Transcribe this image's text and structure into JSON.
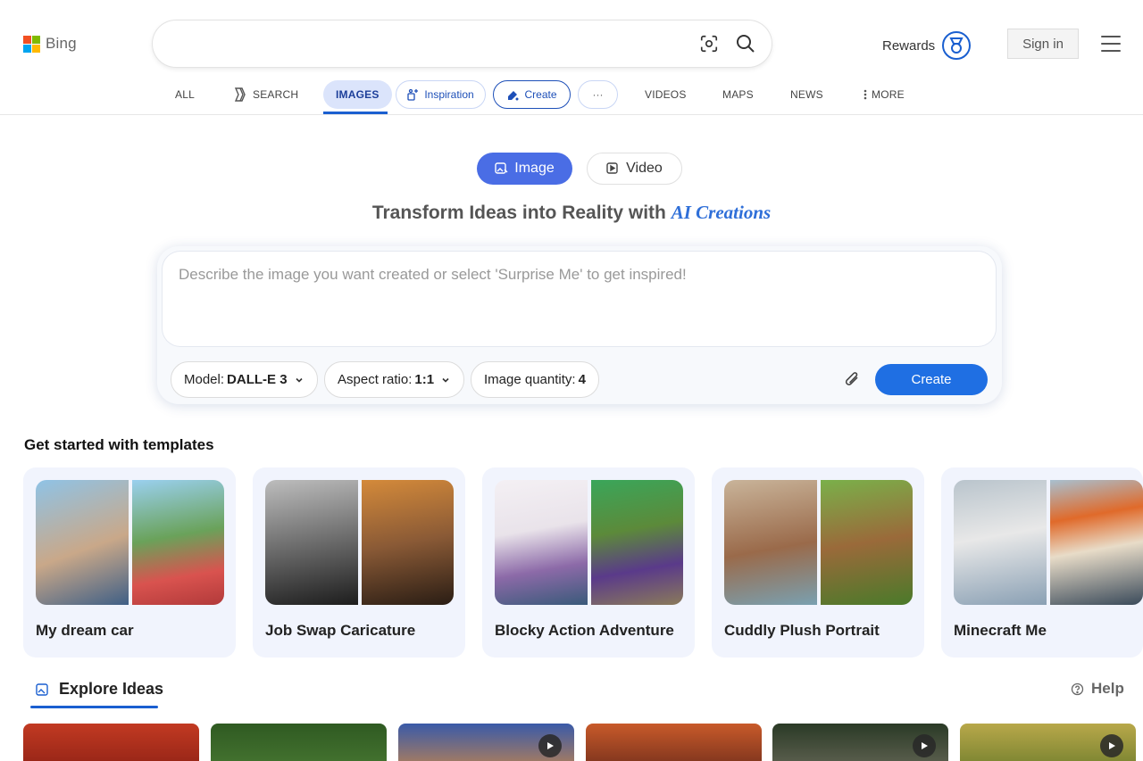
{
  "header": {
    "logo_text": "Bing",
    "search_value": "",
    "rewards_label": "Rewards",
    "signin_label": "Sign in"
  },
  "nav": {
    "all": "ALL",
    "search": "SEARCH",
    "images": "IMAGES",
    "inspiration": "Inspiration",
    "create": "Create",
    "more_dots": "···",
    "videos": "VIDEOS",
    "maps": "MAPS",
    "news": "NEWS",
    "more": "MORE"
  },
  "mode_toggle": {
    "image": "Image",
    "video": "Video",
    "selected": "Image"
  },
  "hero": {
    "title_main": "Transform Ideas into Reality with ",
    "title_accent": "AI Creations"
  },
  "prompt": {
    "placeholder": "Describe the image you want created or select 'Surprise Me' to get inspired!",
    "value": ""
  },
  "options": {
    "model_label": "Model:",
    "model_value": "DALL-E 3",
    "aspect_label": "Aspect ratio:",
    "aspect_value": "1:1",
    "quantity_label": "Image quantity:",
    "quantity_value": "4",
    "create_label": "Create"
  },
  "templates": {
    "title": "Get started with templates",
    "items": [
      {
        "label": "My dream car",
        "colors": [
          "#c9a889",
          "#d9534f"
        ]
      },
      {
        "label": "Job Swap Caricature",
        "colors": [
          "#6d6d6d",
          "#8a5a36"
        ]
      },
      {
        "label": "Blocky Action Adventure",
        "colors": [
          "#e9e3ea",
          "#5c8a3a"
        ]
      },
      {
        "label": "Cuddly Plush Portrait",
        "colors": [
          "#9a6a4a",
          "#6a9a3a"
        ]
      },
      {
        "label": "Minecraft Me",
        "colors": [
          "#b9c4cc",
          "#8aa0b4"
        ]
      }
    ]
  },
  "explore": {
    "title": "Explore Ideas",
    "help": "Help"
  },
  "idea_tiles": [
    {
      "color": "#b8311f",
      "video": false
    },
    {
      "color": "#3d6b2a",
      "video": false
    },
    {
      "color": "#4d6aa8",
      "video": true
    },
    {
      "color": "#a64a2a",
      "video": false
    },
    {
      "color": "#3a4a36",
      "video": true
    },
    {
      "color": "#a39a3a",
      "video": true
    }
  ],
  "colors": {
    "accent": "#1f6fe3",
    "toggle_active": "#4a6de5",
    "card_bg": "#f1f4fd"
  }
}
